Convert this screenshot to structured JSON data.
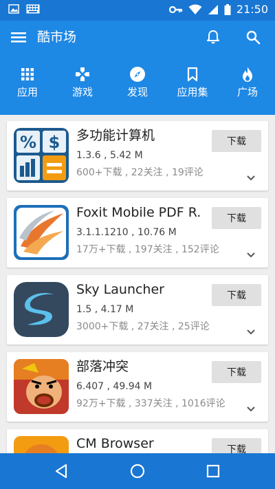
{
  "status_bar": {
    "time": "21:50"
  },
  "app_bar": {
    "title": "酷市场"
  },
  "tabs": [
    {
      "label": "应用",
      "icon": "apps-grid-icon"
    },
    {
      "label": "游戏",
      "icon": "gamepad-icon"
    },
    {
      "label": "发现",
      "icon": "compass-icon"
    },
    {
      "label": "应用集",
      "icon": "bookmark-icon"
    },
    {
      "label": "广场",
      "icon": "flame-icon"
    }
  ],
  "apps": [
    {
      "name": "多功能计算机",
      "version_size": "1.3.6 , 5.42 M",
      "stats": "600+下载 , 22关注 , 19评论",
      "button": "下载",
      "icon": "calculator-app-icon"
    },
    {
      "name": "Foxit Mobile PDF R.",
      "version_size": "3.1.1.1210 , 10.76 M",
      "stats": "17万+下载 , 197关注 , 152评论",
      "button": "下载",
      "icon": "foxit-pdf-app-icon"
    },
    {
      "name": "Sky Launcher",
      "version_size": "1.5 , 4.17 M",
      "stats": "3000+下载 , 27关注 , 25评论",
      "button": "下载",
      "icon": "sky-launcher-app-icon"
    },
    {
      "name": "部落冲突",
      "version_size": "6.407 , 49.94 M",
      "stats": "92万+下载 , 337关注 , 1016评论",
      "button": "下载",
      "icon": "clash-of-clans-app-icon"
    },
    {
      "name": "CM Browser",
      "version_size": "",
      "stats": "",
      "button": "下载",
      "icon": "cm-browser-app-icon"
    }
  ],
  "colors": {
    "primary": "#1e88e5",
    "status_bar": "#1976d2",
    "background": "#eeeeee"
  }
}
